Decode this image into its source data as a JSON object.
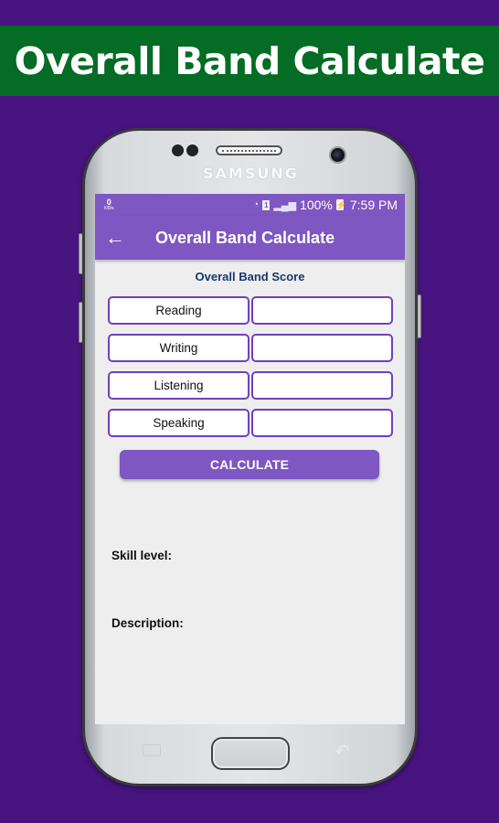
{
  "banner": {
    "title": "Overall Band Calculate"
  },
  "device": {
    "brand": "SAMSUNG"
  },
  "statusbar": {
    "net_speed_value": "0",
    "net_speed_unit": "KB/s",
    "sim_slot": "1",
    "battery": "100%",
    "time": "7:59 PM",
    "icons": [
      "wifi-icon",
      "sim-icon",
      "signal-icon",
      "battery-charging-icon"
    ]
  },
  "toolbar": {
    "title": "Overall Band Calculate",
    "back_icon": "arrow-left-icon"
  },
  "main": {
    "section_title": "Overall Band Score",
    "skills": [
      {
        "label": "Reading",
        "value": ""
      },
      {
        "label": "Writing",
        "value": ""
      },
      {
        "label": "Listening",
        "value": ""
      },
      {
        "label": "Speaking",
        "value": ""
      }
    ],
    "calculate_label": "CALCULATE",
    "skill_level_label": "Skill level:",
    "description_label": "Description:"
  },
  "colors": {
    "background": "#48147f",
    "banner": "#046c24",
    "accent": "#7e57c2",
    "input_border": "#7040bd",
    "section_title": "#17386c"
  }
}
